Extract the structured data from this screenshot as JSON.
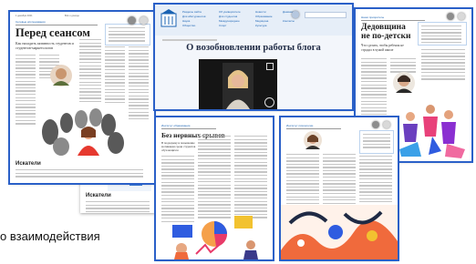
{
  "caption": {
    "text": "о взаимодействия"
  },
  "card1": {
    "date": "1 декабря 2021",
    "section": "Сетевые исследования",
    "section_link": "Всё о доходе",
    "title": "Перед сеансом",
    "subtitle": "Как наладить активность студентов и студентов-маркетологов",
    "footer_brand": "Искатели"
  },
  "card2": {
    "footer_brand": "Искатели"
  },
  "card3": {
    "title": "О возобновлении работы блога",
    "menu": [
      [
        "Разделы сайта",
        "Об университете",
        "Новости",
        "Дневник"
      ],
      [
        "Для абитуриентов",
        "Для студентов",
        "Образование",
        ""
      ],
      [
        "Наука",
        "Международное",
        "Медицина",
        "Контакты"
      ],
      [
        "Общество",
        "Спорт",
        "Культура",
        ""
      ]
    ]
  },
  "card4": {
    "section": "Наши приоритеты",
    "title": "Дедовщина не по-детски",
    "subtitle": "Что сделать, чтобы ребенок не страдал в чужой школе"
  },
  "card5": {
    "section": "Институт образования",
    "title": "Без нервных срывов",
    "subtitle": "В поддержку и повышение мотивации среди студентов обучающихся"
  },
  "card6": {
    "section": "Институт психологии"
  },
  "colors": {
    "accent_blue": "#2a60c8",
    "brand_blue": "#1b63b3"
  }
}
